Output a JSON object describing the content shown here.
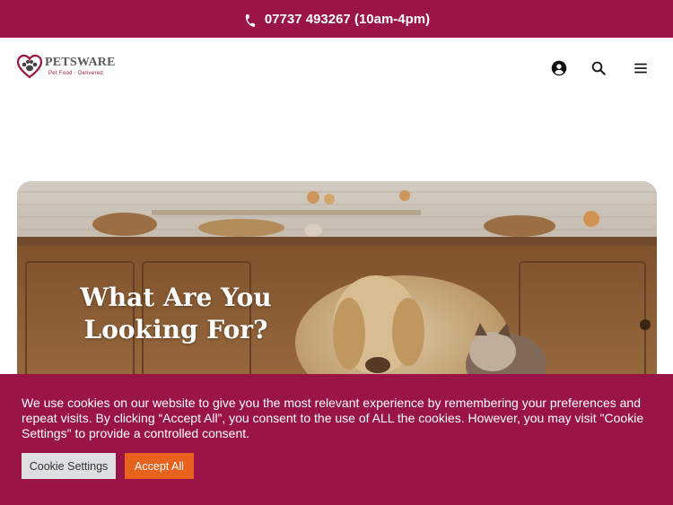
{
  "topbar": {
    "phone_text": "07737 493267 (10am-4pm)",
    "icon": "phone-icon",
    "background": "#9b1448"
  },
  "header": {
    "logo": {
      "name": "PETSWARE",
      "tagline": "Pet Food · Delivered"
    },
    "icons": [
      "user-account-icon",
      "search-icon",
      "menu-icon"
    ]
  },
  "hero": {
    "title": "What Are You Looking For?"
  },
  "cookie_banner": {
    "message": "We use cookies on our website to give you the most relevant experience by remembering your preferences and repeat visits. By clicking “Accept All”, you consent to the use of ALL the cookies. However, you may visit \"Cookie Settings\" to provide a controlled consent.",
    "settings_label": "Cookie Settings",
    "accept_label": "Accept All",
    "accept_color": "#e8621e"
  }
}
